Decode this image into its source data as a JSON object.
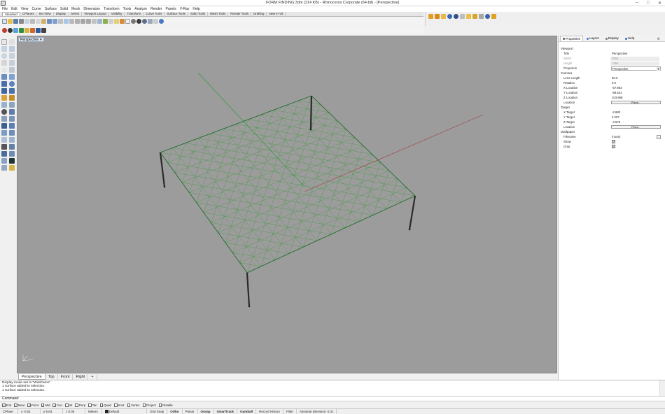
{
  "window": {
    "title": "FORM FINDING.3dm (214 KB) - Rhinoceros Corporate (64-bit) - [Perspective]"
  },
  "menu": [
    "File",
    "Edit",
    "View",
    "Curve",
    "Surface",
    "Solid",
    "Mesh",
    "Dimension",
    "Transform",
    "Tools",
    "Analyze",
    "Render",
    "Panels",
    "V-Ray",
    "Help"
  ],
  "toolbar_tabs": [
    "Standard",
    "CPlanes",
    "Set View",
    "Display",
    "Select",
    "Viewport Layout",
    "Visibility",
    "Transform",
    "Curve Tools",
    "Surface Tools",
    "Solid Tools",
    "Mesh Tools",
    "Render Tools",
    "Drafting",
    "New in V5"
  ],
  "toolbar_active_tab": "Standard",
  "viewport": {
    "label": "Perspective",
    "tabs": [
      "Perspective",
      "Top",
      "Front",
      "Right"
    ],
    "add_tab": "+"
  },
  "panel": {
    "tabs": [
      "Properties",
      "Layers",
      "Display",
      "Help"
    ],
    "active": "Properties",
    "viewport_section": "Viewport",
    "title_label": "Title",
    "title_value": "Perspective",
    "width_label": "Width",
    "width_value": "2064",
    "height_label": "Height",
    "height_value": "1362",
    "projection_label": "Projection",
    "projection_value": "Perspective",
    "camera_section": "Camera",
    "lens_label": "Lens Length",
    "lens_value": "50.0",
    "rotation_label": "Rotation",
    "rotation_value": "0.0",
    "xloc_label": "X Location",
    "xloc_value": "-57.903",
    "yloc_label": "Y Location",
    "yloc_value": "-88.631",
    "zloc_label": "Z Location",
    "zloc_value": "103.868",
    "location_label": "Location",
    "place_button": "Place...",
    "target_section": "Target",
    "xt_label": "X Target",
    "xt_value": "-2.880",
    "yt_label": "Y Target",
    "yt_value": "2.207",
    "zt_label": "Z Target",
    "zt_value": "-4.578",
    "tloc_label": "Location",
    "tplace_button": "Place...",
    "wallpaper_section": "Wallpaper",
    "filename_label": "Filename",
    "filename_value": "(none)",
    "show_label": "Show",
    "gray_label": "Gray"
  },
  "command_history": [
    "Display mode set to \"Wireframe\"",
    "1 surface added to selection.",
    "1 surface added to selection."
  ],
  "command_prompt": "Command:",
  "osnaps": [
    {
      "label": "End",
      "checked": true
    },
    {
      "label": "Near",
      "checked": true
    },
    {
      "label": "Point",
      "checked": true
    },
    {
      "label": "Mid",
      "checked": true
    },
    {
      "label": "Cen",
      "checked": true
    },
    {
      "label": "Int",
      "checked": false
    },
    {
      "label": "Perp",
      "checked": false
    },
    {
      "label": "Tan",
      "checked": false
    },
    {
      "label": "Quad",
      "checked": false
    },
    {
      "label": "Knot",
      "checked": false
    },
    {
      "label": "Vertex",
      "checked": false
    },
    {
      "label": "Project",
      "checked": false
    },
    {
      "label": "Disable",
      "checked": false
    }
  ],
  "status": {
    "cplane": "CPlane",
    "x": "x -0.01",
    "y": "y 6.63",
    "z": "z 0.00",
    "units": "Meters",
    "layer": "Default",
    "grid_snap": "Grid Snap",
    "ortho": "Ortho",
    "planar": "Planar",
    "osnap": "Osnap",
    "smarttrack": "SmartTrack",
    "gumball": "Gumball",
    "record_history": "Record History",
    "filter": "Filter",
    "tolerance": "Absolute tolerance: 0.01"
  }
}
